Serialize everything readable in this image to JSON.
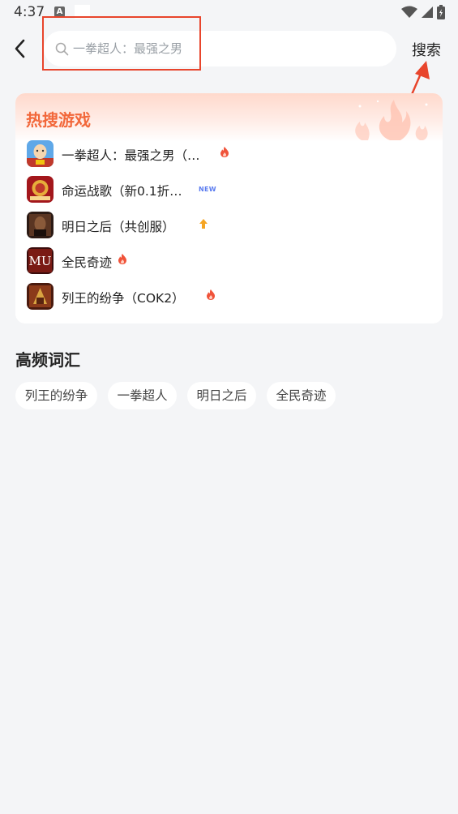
{
  "status": {
    "time": "4:37",
    "a_badge": "A"
  },
  "header": {
    "search_placeholder": "一拳超人：最强之男",
    "search_label": "搜索"
  },
  "hot": {
    "title": "热搜游戏",
    "items": [
      {
        "name": "一拳超人：最强之男（…",
        "tag": "fire",
        "icon": "one-punch-man-game-icon"
      },
      {
        "name": "命运战歌（新0.1折…",
        "tag": "new",
        "tag_text": "NEW",
        "icon": "fate-war-song-game-icon"
      },
      {
        "name": "明日之后（共创服）",
        "tag": "up",
        "icon": "tomorrow-game-icon"
      },
      {
        "name": "全民奇迹",
        "tag": "fire",
        "icon": "mu-miracle-game-icon"
      },
      {
        "name": "列王的纷争（COK2）",
        "tag": "fire",
        "icon": "clash-of-kings-game-icon"
      }
    ]
  },
  "frequent": {
    "title": "高频词汇",
    "chips": [
      "列王的纷争",
      "一拳超人",
      "明日之后",
      "全民奇迹"
    ]
  },
  "colors": {
    "accent": "#f2683b",
    "highlight": "#e8452c",
    "new_tag": "#5b7cf0"
  }
}
